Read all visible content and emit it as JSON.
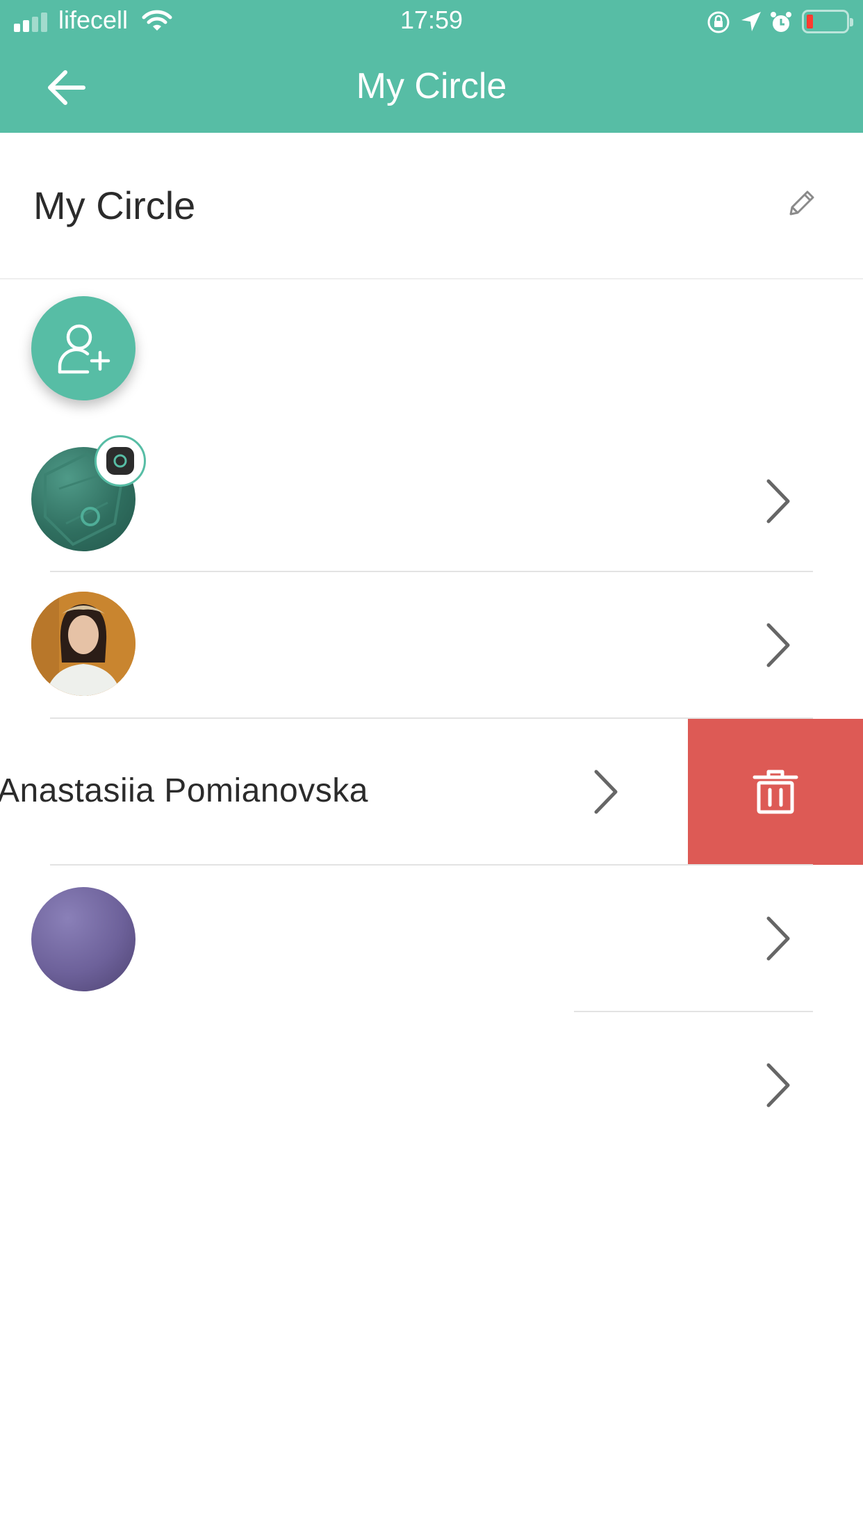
{
  "status_bar": {
    "carrier": "lifecell",
    "time": "17:59",
    "battery_level_percent": 10
  },
  "nav": {
    "title": "My Circle",
    "back_icon": "arrow-left-icon"
  },
  "section": {
    "title": "My Circle",
    "edit_icon": "pencil-icon"
  },
  "add_member": {
    "icon": "add-person-icon"
  },
  "members": [
    {
      "name": "",
      "avatar": "device-avatar"
    },
    {
      "name": "",
      "avatar": "photo-avatar"
    },
    {
      "name": "Anastasiia Pomianovska",
      "avatar": ""
    },
    {
      "name": "",
      "avatar": "purple-avatar"
    },
    {
      "name": "",
      "avatar": ""
    }
  ],
  "delete_action": {
    "icon": "trash-icon"
  },
  "colors": {
    "brand": "#57bda5",
    "delete": "#dd5a55"
  }
}
